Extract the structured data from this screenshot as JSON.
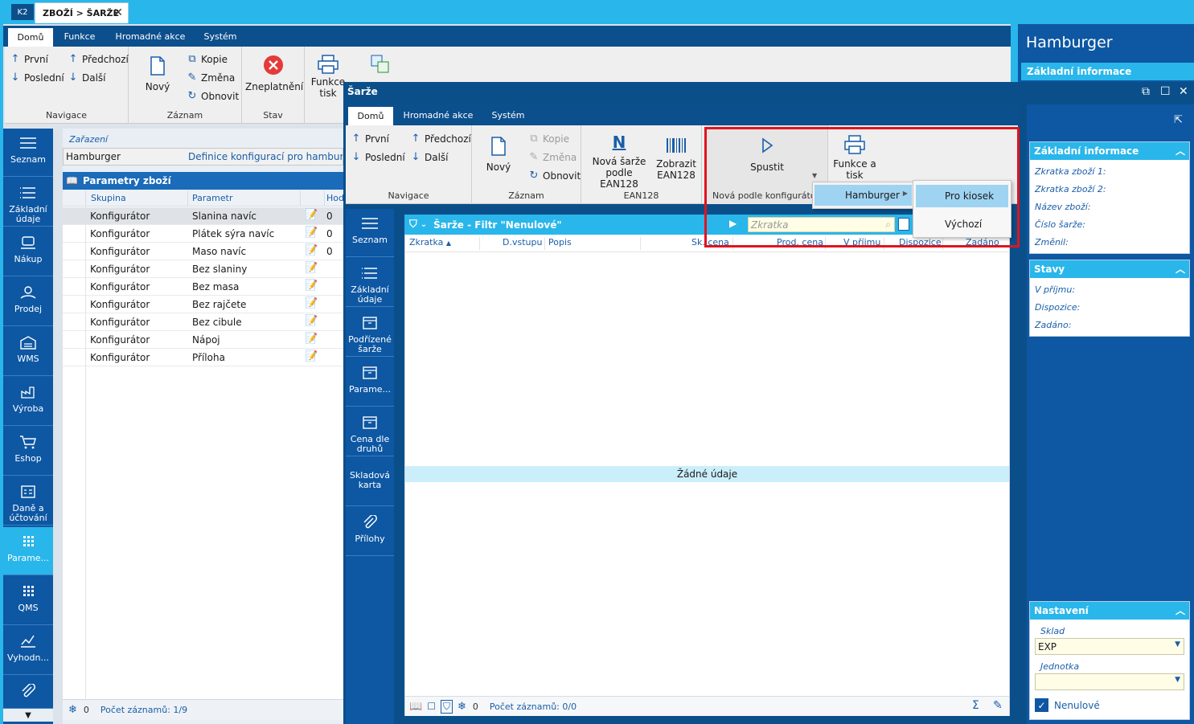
{
  "app": {
    "logo": "K2",
    "doc_tab": "ZBOŽÍ > ŠARŽE"
  },
  "main_ribbon": {
    "tabs": [
      "Domů",
      "Funkce",
      "Hromadné akce",
      "Systém"
    ],
    "navigace": {
      "first": "První",
      "prev": "Předchozí",
      "last": "Poslední",
      "next": "Další",
      "label": "Navigace"
    },
    "zaznam": {
      "new": "Nový",
      "copy": "Kopie",
      "change": "Změna",
      "refresh": "Obnovit",
      "label": "Záznam"
    },
    "stav": {
      "invalidate": "Zneplatnění",
      "label": "Stav"
    },
    "funkce": {
      "line1": "Funkce",
      "line2": "tisk"
    }
  },
  "left_nav": [
    "Seznam",
    "Základní údaje",
    "Nákup",
    "Prodej",
    "WMS",
    "Výroba",
    "Eshop",
    "Daně a účtování",
    "Parame...",
    "QMS",
    "Vyhodn..."
  ],
  "content": {
    "zarazeni_label": "Zařazení",
    "zarazeni_value": "Hamburger",
    "zarazeni_desc": "Definice konfigurací pro hamburg",
    "params_title": "Parametry zboží",
    "columns": [
      "Skupina",
      "Parametr",
      "Hod"
    ],
    "rows": [
      {
        "group": "Konfigurátor",
        "param": "Slanina navíc",
        "val": "0"
      },
      {
        "group": "Konfigurátor",
        "param": "Plátek sýra navíc",
        "val": "0"
      },
      {
        "group": "Konfigurátor",
        "param": "Maso navíc",
        "val": "0"
      },
      {
        "group": "Konfigurátor",
        "param": "Bez slaniny",
        "val": ""
      },
      {
        "group": "Konfigurátor",
        "param": "Bez masa",
        "val": ""
      },
      {
        "group": "Konfigurátor",
        "param": "Bez rajčete",
        "val": ""
      },
      {
        "group": "Konfigurátor",
        "param": "Bez cibule",
        "val": ""
      },
      {
        "group": "Konfigurátor",
        "param": "Nápoj",
        "val": ""
      },
      {
        "group": "Konfigurátor",
        "param": "Příloha",
        "val": ""
      }
    ],
    "status_count": "0",
    "status_records": "Počet záznamů: 1/9"
  },
  "right_outer": {
    "title": "Hamburger",
    "section": "Základní informace"
  },
  "dialog": {
    "title": "Šarže",
    "tabs": [
      "Domů",
      "Hromadné akce",
      "Systém"
    ],
    "navigace": {
      "first": "První",
      "prev": "Předchozí",
      "last": "Poslední",
      "next": "Další",
      "label": "Navigace"
    },
    "zaznam": {
      "new": "Nový",
      "copy": "Kopie",
      "change": "Změna",
      "refresh": "Obnovit",
      "label": "Záznam"
    },
    "ean": {
      "new_line1": "Nová šarže",
      "new_line2": "podle EAN128",
      "show_line1": "Zobrazit",
      "show_line2": "EAN128",
      "label": "EAN128"
    },
    "konfig": {
      "run": "Spustit",
      "label": "Nová podle konfigurátoru"
    },
    "print": {
      "line1": "Funkce a",
      "line2": "tisk"
    },
    "nav": [
      "Seznam",
      "Základní údaje",
      "Podřízené šarže",
      "Parame...",
      "Cena dle druhů",
      "Skladová karta",
      "Přílohy"
    ],
    "filter_title": "Šarže - Filtr \"Nenulové\"",
    "search_placeholder": "Zkratka",
    "columns": [
      "Zkratka",
      "D.vstupu",
      "Popis",
      "Sk. cena",
      "Prod. cena",
      "V příjmu",
      "Dispozice",
      "Zadáno"
    ],
    "no_data": "Žádné údaje",
    "status_count": "0",
    "status_records": "Počet záznamů: 0/0"
  },
  "menu": {
    "item": "Hamburger",
    "sub": [
      "Pro kiosek",
      "Výchozí"
    ]
  },
  "dialog_right": {
    "zakladni": {
      "title": "Základní informace",
      "fields": [
        "Zkratka zboží 1:",
        "Zkratka zboží 2:",
        "Název zboží:",
        "Číslo šarže:",
        "Změnil:"
      ]
    },
    "stavy": {
      "title": "Stavy",
      "fields": [
        "V příjmu:",
        "Dispozice:",
        "Zadáno:"
      ]
    },
    "nastaveni": {
      "title": "Nastavení",
      "sklad_label": "Sklad",
      "sklad_value": "EXP",
      "jednotka_label": "Jednotka",
      "jednotka_value": "",
      "nenulove": "Nenulové"
    }
  },
  "colors": {
    "accent": "#29b6ea",
    "nav": "#0d57a3",
    "highlight": "#e0141e"
  }
}
